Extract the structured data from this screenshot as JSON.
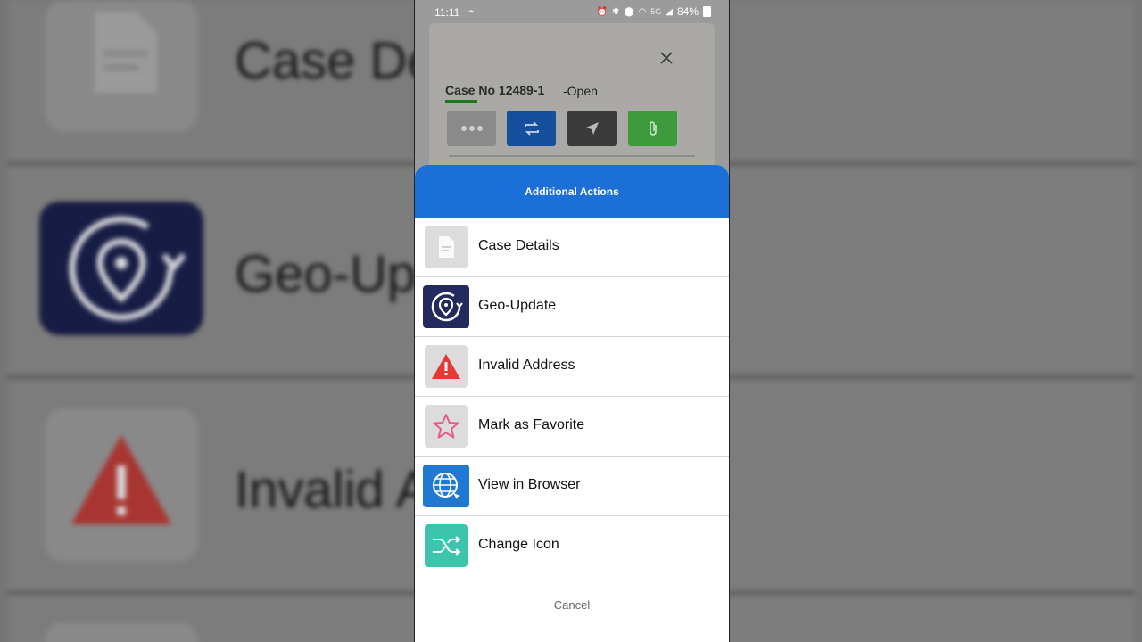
{
  "status_bar": {
    "time": "11:11",
    "network": "5G",
    "battery": "84%"
  },
  "case": {
    "title": "Case No 12489-1",
    "status": "-Open"
  },
  "sheet": {
    "title": "Additional Actions",
    "cancel_label": "Cancel",
    "items": [
      {
        "label": "Case Details",
        "icon": "document-icon"
      },
      {
        "label": "Geo-Update",
        "icon": "geo-update-icon"
      },
      {
        "label": "Invalid Address",
        "icon": "warning-icon"
      },
      {
        "label": "Mark as Favorite",
        "icon": "star-icon"
      },
      {
        "label": "View in Browser",
        "icon": "globe-icon"
      },
      {
        "label": "Change Icon",
        "icon": "shuffle-icon"
      }
    ]
  },
  "background": {
    "labels": [
      "Case De",
      "Geo-Upd",
      "Invalid A"
    ]
  },
  "colors": {
    "header_blue": "#1c6fd6",
    "geo_navy": "#232a5e",
    "warning_red": "#e53935",
    "star_pink": "#e85a8a",
    "browser_blue": "#1f78d1",
    "change_teal": "#3cc4ad",
    "attach_green": "#3d9a3d"
  }
}
